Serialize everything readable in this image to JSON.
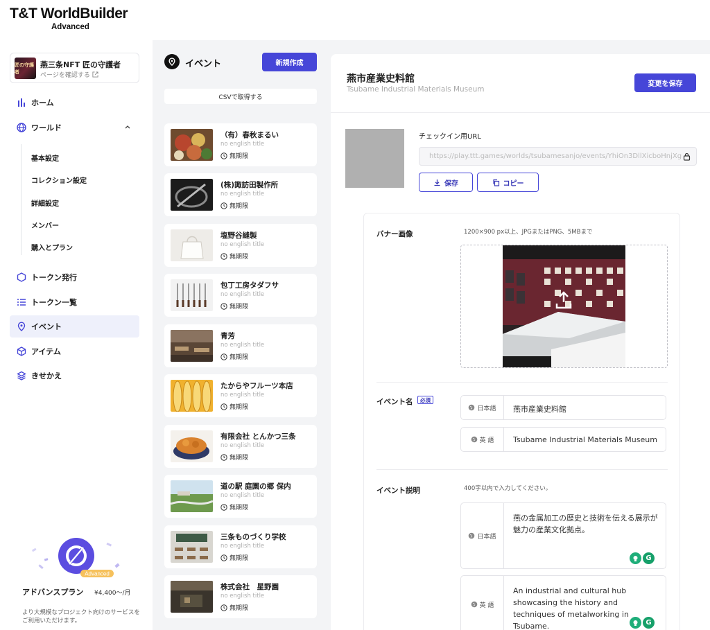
{
  "brand": {
    "logo": "T&T WorldBuilder",
    "edition": "Advanced"
  },
  "sidebar": {
    "world": {
      "thumb_text": "匠の守護者",
      "name": "燕三条NFT 匠の守護者",
      "link": "ページを確認する"
    },
    "nav": {
      "home": "ホーム",
      "world": "ワールド",
      "token_issue": "トークン発行",
      "token_list": "トークン一覧",
      "event": "イベント",
      "item": "アイテム",
      "dressup": "きせかえ"
    },
    "world_sub": [
      "基本設定",
      "コレクション設定",
      "詳細設定",
      "メンバー",
      "購入とプラン"
    ],
    "plan": {
      "badge": "Advanced",
      "title": "アドバンスプラン",
      "price": "¥4,400〜/月",
      "description": "より大規模なプロジェクト向けのサービスをご利用いただけます。"
    }
  },
  "list": {
    "title": "イベント",
    "new_button": "新規作成",
    "csv_button": "CSVで取得する",
    "events": [
      {
        "title": "（有）春秋まるい",
        "subtitle": "no english title",
        "period": "無期限"
      },
      {
        "title": "(株)諏訪田製作所",
        "subtitle": "no english title",
        "period": "無期限"
      },
      {
        "title": "塩野谷縫製",
        "subtitle": "no english title",
        "period": "無期限"
      },
      {
        "title": "包丁工房タダフサ",
        "subtitle": "no english title",
        "period": "無期限"
      },
      {
        "title": "青芳",
        "subtitle": "no english title",
        "period": "無期限"
      },
      {
        "title": "たからやフルーツ本店",
        "subtitle": "no english title",
        "period": "無期限"
      },
      {
        "title": "有限会社 とんかつ三条",
        "subtitle": "no english title",
        "period": "無期限"
      },
      {
        "title": "道の駅 庭園の郷 保内",
        "subtitle": "no english title",
        "period": "無期限"
      },
      {
        "title": "三条ものづくり学校",
        "subtitle": "no english title",
        "period": "無期限"
      },
      {
        "title": "株式会社　星野園",
        "subtitle": "no english title",
        "period": "無期限"
      }
    ]
  },
  "detail": {
    "title": "燕市産業史料館",
    "subtitle": "Tsubame Industrial Materials Museum",
    "save_button": "変更を保存",
    "checkin_label": "チェックイン用URL",
    "checkin_url": "https://play.ttt.games/worlds/tsubamesanjo/events/YhiOn3DllXicboHnjXg",
    "save_qr_button": "保存",
    "copy_button": "コピー",
    "banner_label": "バナー画像",
    "banner_hint": "1200×900 px以上、JPGまたはPNG、5MBまで",
    "event_name_label": "イベント名",
    "required_badge": "必須",
    "lang_ja": "日本語",
    "lang_en": "英 語",
    "name_ja": "燕市産業史料館",
    "name_en": "Tsubame Industrial Materials Museum",
    "desc_label": "イベント説明",
    "desc_hint": "400字以内で入力してください。",
    "desc_ja": "燕の金属加工の歴史と技術を伝える展示が魅力の産業文化拠点。",
    "desc_en": "An industrial and cultural hub showcasing the history and techniques of metalworking in Tsubame."
  }
}
